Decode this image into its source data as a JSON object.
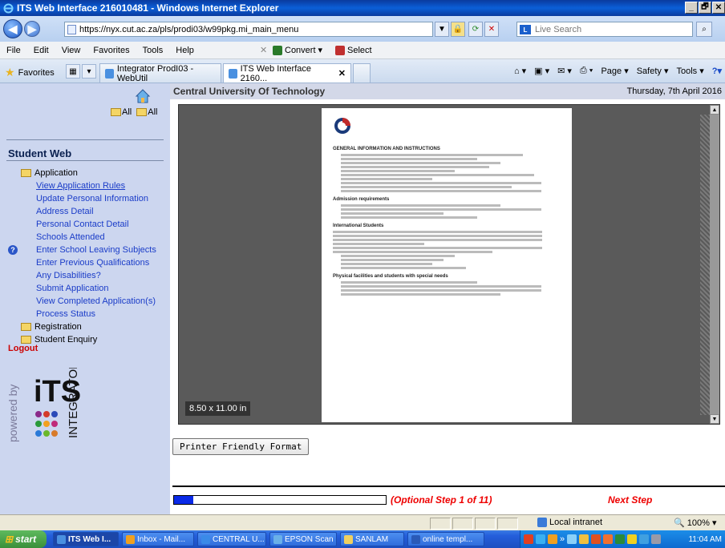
{
  "window": {
    "title": "ITS Web Interface 216010481 - Windows Internet Explorer",
    "controls": [
      "_",
      "🗗",
      "✕"
    ]
  },
  "address": {
    "url": "https://nyx.cut.ac.za/pls/prodi03/w99pkg.mi_main_menu",
    "search_placeholder": "Live Search"
  },
  "menu": {
    "items": [
      "File",
      "Edit",
      "View",
      "Favorites",
      "Tools",
      "Help"
    ],
    "convert": "Convert",
    "select": "Select"
  },
  "tabs": {
    "favorites": "Favorites",
    "items": [
      {
        "label": "Integrator ProdI03 - WebUtil"
      },
      {
        "label": "ITS Web Interface 2160...",
        "close": "✕"
      }
    ]
  },
  "commandbar": {
    "page": "Page",
    "safety": "Safety",
    "tools": "Tools"
  },
  "sidebar": {
    "all_labels": [
      "All",
      "All"
    ],
    "title": "Student Web",
    "items": [
      {
        "label": "Application",
        "type": "folder"
      },
      {
        "label": "View Application Rules",
        "type": "link",
        "underline": true
      },
      {
        "label": "Update Personal Information",
        "type": "link"
      },
      {
        "label": "Address Detail",
        "type": "link"
      },
      {
        "label": "Personal Contact Detail",
        "type": "link"
      },
      {
        "label": "Schools Attended",
        "type": "link"
      },
      {
        "label": "Enter School Leaving Subjects",
        "type": "link"
      },
      {
        "label": "Enter Previous Qualifications",
        "type": "link"
      },
      {
        "label": "Any Disabilities?",
        "type": "link"
      },
      {
        "label": "Submit Application",
        "type": "link"
      },
      {
        "label": "View Completed Application(s)",
        "type": "link"
      },
      {
        "label": "Process Status",
        "type": "link"
      },
      {
        "label": "Registration",
        "type": "folder"
      },
      {
        "label": "Student Enquiry",
        "type": "folder"
      }
    ],
    "logout": "Logout",
    "powered_by": "powered by",
    "logo_text": "iTS",
    "logo_sub": "INTEGRATOR"
  },
  "main": {
    "organisation": "Central University Of Technology",
    "date": "Thursday, 7th April 2016",
    "page_size": "8.50 x 11.00 in",
    "printer_button": "Printer Friendly Format",
    "step_text": "(Optional Step 1 of 11)",
    "next_step": "Next Step",
    "progress": 0.09
  },
  "document": {
    "heading1": "GENERAL INFORMATION AND INSTRUCTIONS",
    "heading2": "Admission requirements",
    "heading3": "International Students",
    "heading4": "Physical facilities and students with special needs"
  },
  "status": {
    "zone": "Local intranet",
    "zoom": "100%"
  },
  "taskbar": {
    "start": "start",
    "items": [
      {
        "label": "ITS Web I..."
      },
      {
        "label": "Inbox - Mail..."
      },
      {
        "label": "CENTRAL U..."
      },
      {
        "label": "EPSON Scan"
      },
      {
        "label": "SANLAM"
      },
      {
        "label": "online templ..."
      }
    ],
    "clock": "11:04 AM"
  }
}
